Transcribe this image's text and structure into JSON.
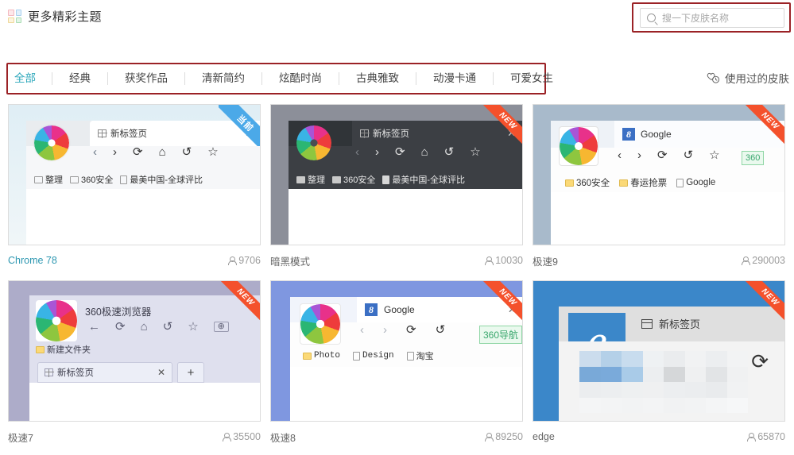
{
  "header": {
    "title": "更多精彩主题",
    "grid_icon": "grid-squares-icon"
  },
  "search": {
    "placeholder": "搜一下皮肤名称",
    "value": "",
    "icon": "search-icon",
    "annotation_color": "#9b2226"
  },
  "tabs": {
    "annotation_color": "#9b2226",
    "active_color": "#2ba7bb",
    "items": [
      {
        "label": "全部",
        "active": true
      },
      {
        "label": "经典",
        "active": false
      },
      {
        "label": "获奖作品",
        "active": false
      },
      {
        "label": "清新简约",
        "active": false
      },
      {
        "label": "炫酷时尚",
        "active": false
      },
      {
        "label": "古典雅致",
        "active": false
      },
      {
        "label": "动漫卡通",
        "active": false
      },
      {
        "label": "可爱女生",
        "active": false
      }
    ]
  },
  "used_skins": {
    "label": "使用过的皮肤",
    "icon": "history-heart-icon"
  },
  "cards": [
    {
      "name": "Chrome 78",
      "views": "9706",
      "badge": "当前",
      "badge_type": "current",
      "badge_color": "#4ba9e8",
      "current": true,
      "tab_title": "新标签页",
      "bookmarks": [
        "整理",
        "360安全",
        "最美中国-全球评比"
      ],
      "theme": "light"
    },
    {
      "name": "暗黑模式",
      "views": "10030",
      "badge": "NEW",
      "badge_type": "new",
      "badge_color": "#f4512c",
      "current": false,
      "tab_title": "新标签页",
      "bookmarks": [
        "整理",
        "360安全",
        "最美中国-全球评比"
      ],
      "theme": "dark"
    },
    {
      "name": "极速9",
      "views": "290003",
      "badge": "NEW",
      "badge_type": "new",
      "badge_color": "#f4512c",
      "current": false,
      "tab_title": "Google",
      "address_chip": "360",
      "bookmarks": [
        "360安全",
        "春运抢票",
        "Google"
      ],
      "theme": "blue-gray"
    },
    {
      "name": "极速7",
      "views": "35500",
      "badge": "NEW",
      "badge_type": "new",
      "badge_color": "#f4512c",
      "current": false,
      "tab_title": "360极速浏览器",
      "bottom_tab": "新标签页",
      "bookmarks": [
        "新建文件夹"
      ],
      "theme": "lavender"
    },
    {
      "name": "极速8",
      "views": "89250",
      "badge": "NEW",
      "badge_type": "new",
      "badge_color": "#f4512c",
      "current": false,
      "tab_title": "Google",
      "address_chip": "360导航",
      "bookmarks": [
        "Photo",
        "Design",
        "淘宝"
      ],
      "theme": "periwinkle"
    },
    {
      "name": "edge",
      "views": "65870",
      "badge": "NEW",
      "badge_type": "new",
      "badge_color": "#f4512c",
      "current": false,
      "tab_title": "新标签页",
      "bookmarks": [],
      "theme": "edge-blue"
    }
  ]
}
